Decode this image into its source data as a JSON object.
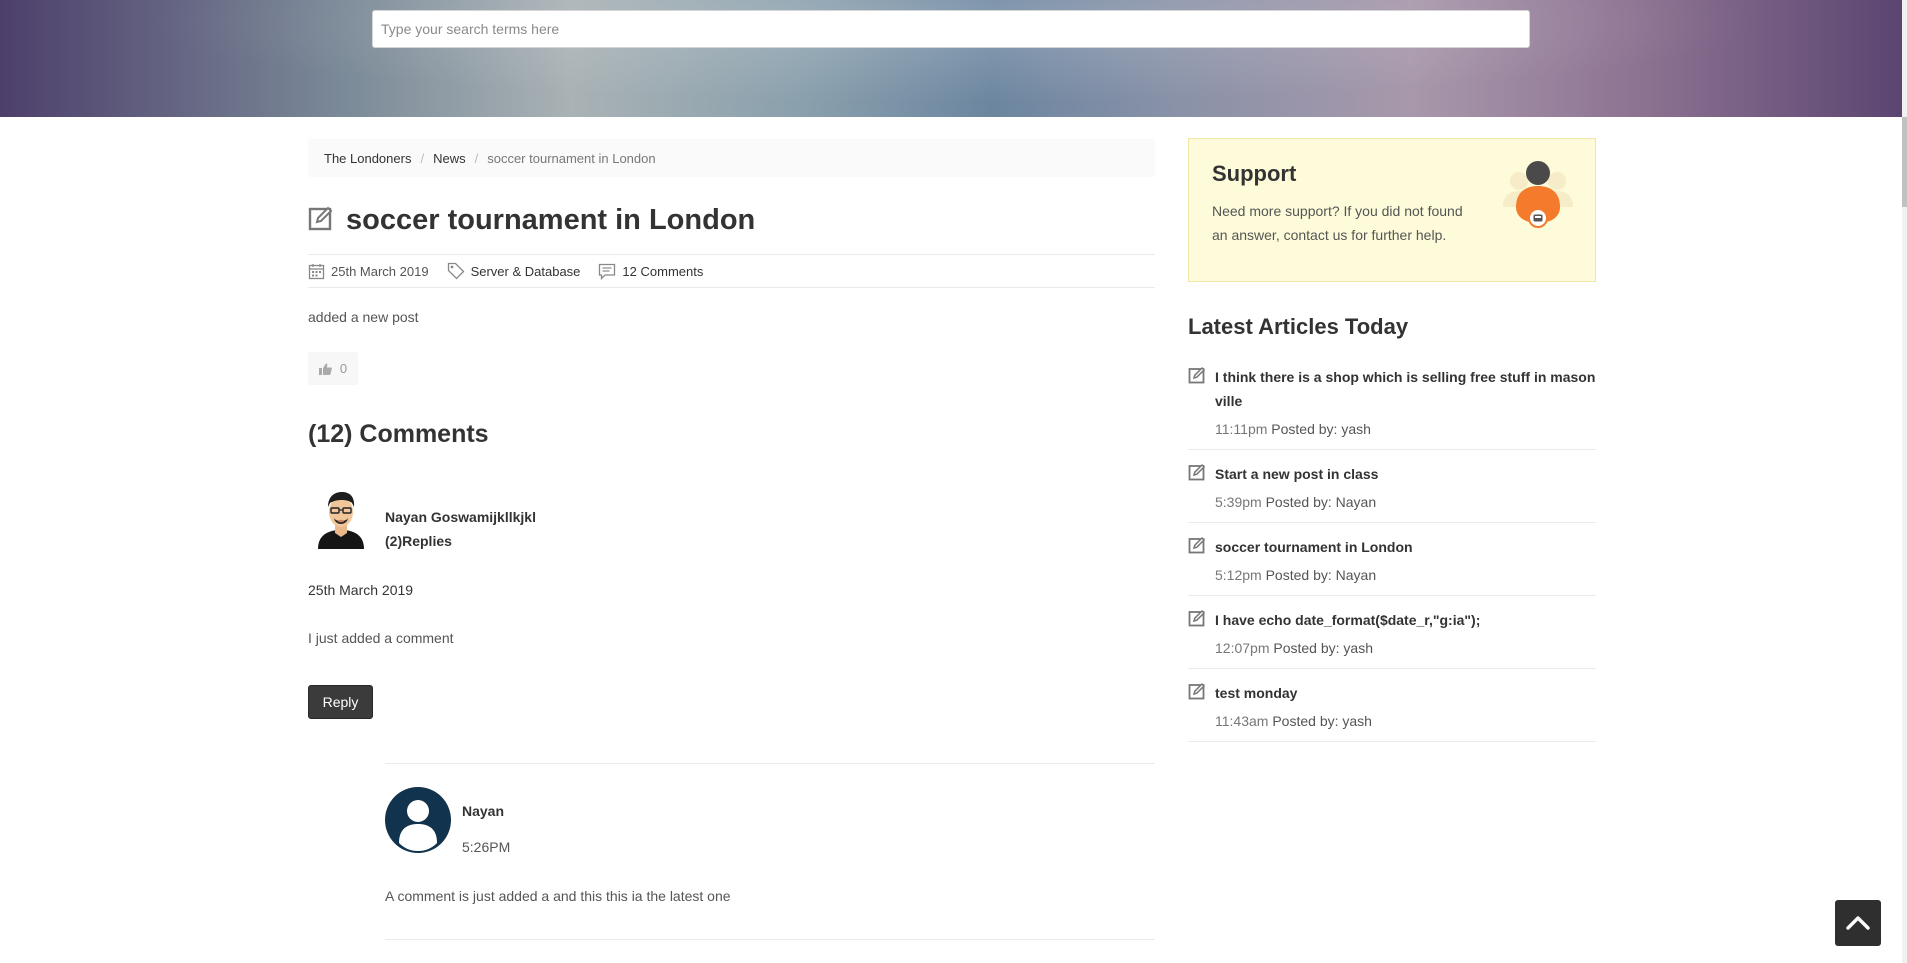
{
  "search": {
    "placeholder": "Type your search terms here"
  },
  "breadcrumb": {
    "items": [
      "The Londoners",
      "News"
    ],
    "current": "soccer tournament in London",
    "separator": "/"
  },
  "post": {
    "title": "soccer tournament in London",
    "date": "25th March 2019",
    "category": "Server & Database",
    "comments_link": "12 Comments",
    "body": "added a new post",
    "likes": "0"
  },
  "comments": {
    "heading": "(12) Comments",
    "first": {
      "author": "Nayan Goswamijkllkjkl",
      "replies": "(2)Replies",
      "date": "25th March 2019",
      "text": "I just added a comment",
      "reply_label": "Reply"
    },
    "reply": {
      "author": "Nayan",
      "time": "5:26PM",
      "text": "A comment is just added a and this this ia the latest one"
    }
  },
  "support": {
    "title": "Support",
    "text": "Need more support? If you did not found an answer, contact us for further help."
  },
  "latest": {
    "title": "Latest Articles Today",
    "posted_by_label": "Posted by:",
    "items": [
      {
        "title": "I think there is a shop which is selling free stuff in mason ville",
        "time": "11:11pm",
        "author": "yash"
      },
      {
        "title": "Start a new post in class",
        "time": "5:39pm",
        "author": "Nayan"
      },
      {
        "title": "soccer tournament in London",
        "time": "5:12pm",
        "author": "Nayan"
      },
      {
        "title": "I have echo date_format($date_r,\"g:ia\");",
        "time": "12:07pm",
        "author": "yash"
      },
      {
        "title": "test monday",
        "time": "11:43am",
        "author": "yash"
      }
    ]
  },
  "icons": {
    "edit": "edit-icon",
    "calendar": "calendar-icon",
    "tag": "tag-icon",
    "comment": "comment-icon",
    "thumbs_up": "thumbs-up-icon",
    "scroll_top": "chevron-up-icon"
  },
  "colors": {
    "support_bg": "#fdfbd9",
    "support_accent": "#f37b2b",
    "reply_button": "#3b3b3b",
    "avatar_dark": "#12334d"
  }
}
